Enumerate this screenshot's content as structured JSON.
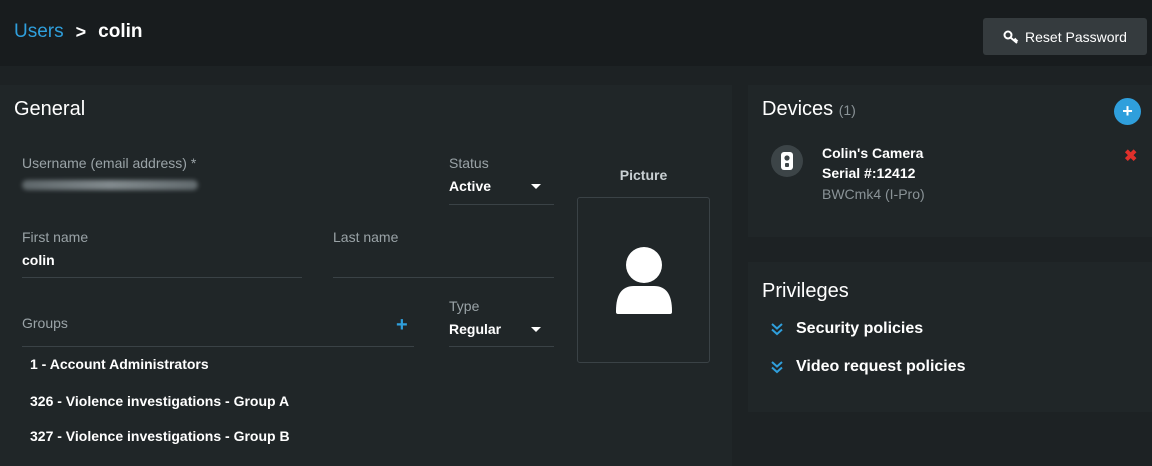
{
  "breadcrumb": {
    "parent": "Users",
    "separator": ">",
    "current": "colin"
  },
  "header": {
    "reset_password_label": "Reset Password"
  },
  "general": {
    "title": "General",
    "username_label": "Username (email address) *",
    "status_label": "Status",
    "status_value": "Active",
    "first_name_label": "First name",
    "first_name_value": "colin",
    "last_name_label": "Last name",
    "last_name_value": "",
    "type_label": "Type",
    "type_value": "Regular",
    "groups_label": "Groups",
    "groups": [
      "1 - Account Administrators",
      "326 - Violence investigations - Group A",
      "327 - Violence investigations - Group B"
    ],
    "picture_label": "Picture"
  },
  "devices": {
    "title": "Devices",
    "count": "(1)",
    "items": [
      {
        "name": "Colin's Camera",
        "serial": "Serial #:12412",
        "model": "BWCmk4 (I-Pro)"
      }
    ]
  },
  "privileges": {
    "title": "Privileges",
    "items": [
      "Security policies",
      "Video request policies"
    ]
  },
  "colors": {
    "accent": "#2f9fdc",
    "danger": "#e0302b",
    "background": "#1d2224",
    "panel": "#202628"
  }
}
